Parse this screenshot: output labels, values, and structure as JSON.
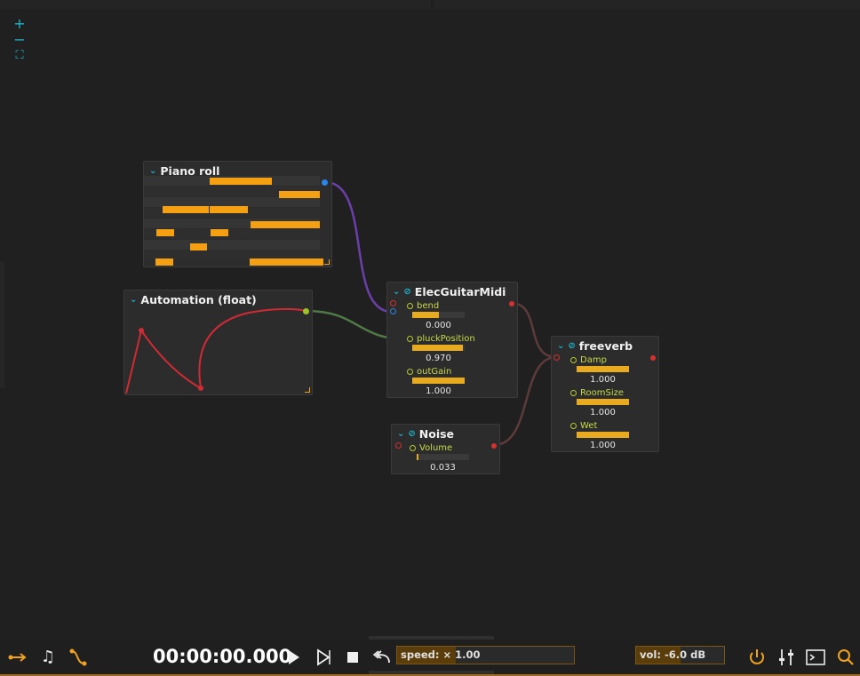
{
  "zoom": {
    "in": "+",
    "out": "−",
    "fit": "⛶"
  },
  "nodes": {
    "piano_roll": {
      "title": "Piano roll"
    },
    "automation": {
      "title": "Automation (float)"
    },
    "elec_guitar": {
      "title": "ElecGuitarMidi",
      "params": [
        {
          "label": "bend",
          "value": "0.000",
          "fill": 0.5
        },
        {
          "label": "pluckPosition",
          "value": "0.970",
          "fill": 0.97
        },
        {
          "label": "outGain",
          "value": "1.000",
          "fill": 1.0
        }
      ]
    },
    "freeverb": {
      "title": "freeverb",
      "params": [
        {
          "label": "Damp",
          "value": "1.000",
          "fill": 1.0
        },
        {
          "label": "RoomSize",
          "value": "1.000",
          "fill": 1.0
        },
        {
          "label": "Wet",
          "value": "1.000",
          "fill": 1.0
        }
      ]
    },
    "noise": {
      "title": "Noise",
      "params": [
        {
          "label": "Volume",
          "value": "0.033",
          "fill": 0.033
        }
      ]
    }
  },
  "transport": {
    "time": "00:00:00.000",
    "speed_label": "speed: × 1.00",
    "speed_fill": 0.33,
    "vol_label": "vol: -6.0 dB",
    "vol_fill": 0.5
  },
  "colors": {
    "accent": "#f2a21b",
    "cyan": "#19b4cf",
    "port_red": "#d7312f",
    "midi_wire": "#6a3fa8",
    "auto_wire": "#4f7a45",
    "audio_wire": "#5e3b3b"
  }
}
